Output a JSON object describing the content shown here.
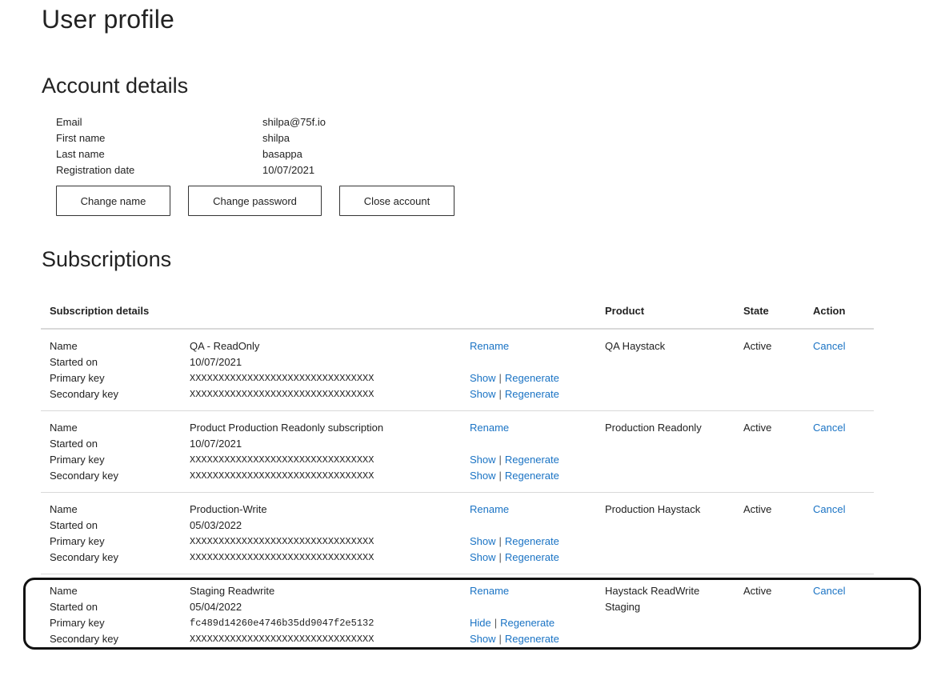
{
  "page_title": "User profile",
  "account": {
    "title": "Account details",
    "fields": [
      {
        "label": "Email",
        "value": "shilpa@75f.io"
      },
      {
        "label": "First name",
        "value": "shilpa"
      },
      {
        "label": "Last name",
        "value": "basappa"
      },
      {
        "label": "Registration date",
        "value": "10/07/2021"
      }
    ],
    "buttons": {
      "change_name": "Change name",
      "change_password": "Change password",
      "close_account": "Close account"
    }
  },
  "subscriptions": {
    "title": "Subscriptions",
    "headers": {
      "details": "Subscription details",
      "product": "Product",
      "state": "State",
      "action": "Action"
    },
    "labels": {
      "name": "Name",
      "started_on": "Started on",
      "primary_key": "Primary key",
      "secondary_key": "Secondary key"
    },
    "links": {
      "rename": "Rename",
      "show": "Show",
      "hide": "Hide",
      "regenerate": "Regenerate",
      "separator": "|",
      "cancel": "Cancel"
    },
    "items": [
      {
        "name": "QA - ReadOnly",
        "started_on": "10/07/2021",
        "primary_key": "XXXXXXXXXXXXXXXXXXXXXXXXXXXXXXXX",
        "secondary_key": "XXXXXXXXXXXXXXXXXXXXXXXXXXXXXXXX",
        "primary_toggle": "Show",
        "product": "QA Haystack",
        "state": "Active",
        "action": "Cancel"
      },
      {
        "name": "Product Production Readonly subscription",
        "started_on": "10/07/2021",
        "primary_key": "XXXXXXXXXXXXXXXXXXXXXXXXXXXXXXXX",
        "secondary_key": "XXXXXXXXXXXXXXXXXXXXXXXXXXXXXXXX",
        "primary_toggle": "Show",
        "product": "Production Readonly",
        "state": "Active",
        "action": "Cancel"
      },
      {
        "name": "Production-Write",
        "started_on": "05/03/2022",
        "primary_key": "XXXXXXXXXXXXXXXXXXXXXXXXXXXXXXXX",
        "secondary_key": "XXXXXXXXXXXXXXXXXXXXXXXXXXXXXXXX",
        "primary_toggle": "Show",
        "product": "Production Haystack",
        "state": "Active",
        "action": "Cancel"
      },
      {
        "name": "Staging Readwrite",
        "started_on": "05/04/2022",
        "primary_key": "fc489d14260e4746b35dd9047f2e5132",
        "secondary_key": "XXXXXXXXXXXXXXXXXXXXXXXXXXXXXXXX",
        "primary_toggle": "Hide",
        "product": "Haystack ReadWrite Staging",
        "state": "Active",
        "action": "Cancel"
      }
    ]
  }
}
